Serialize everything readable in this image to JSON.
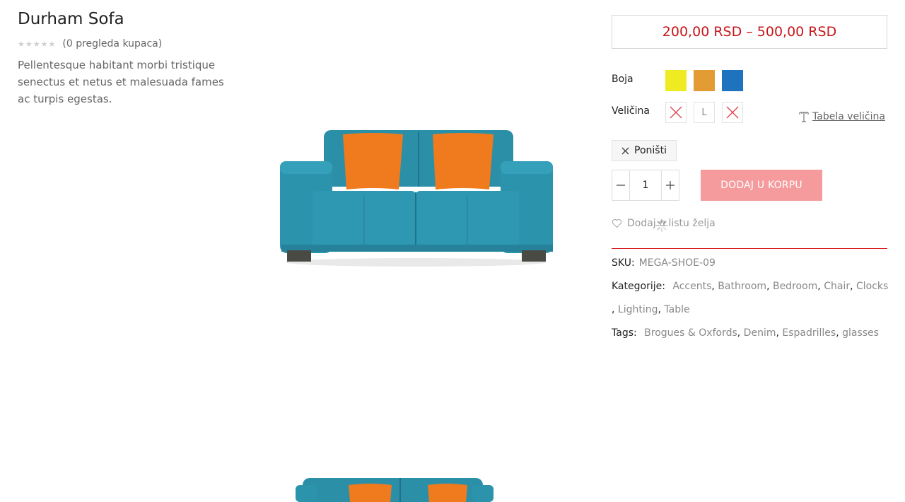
{
  "product": {
    "title": "Durham Sofa",
    "review_count_text": "(0 pregleda kupaca)",
    "rating": 0,
    "rating_max": 5,
    "description": "Pellentesque habitant morbi tristique senectus et netus et malesuada fames ac turpis egestas."
  },
  "price": {
    "text": "200,00 RSD – 500,00 RSD",
    "color": "#c6161a"
  },
  "options": {
    "color_label": "Boja",
    "colors": [
      "#eeeb22",
      "#e39b33",
      "#1e73be"
    ],
    "size_label": "Veličina",
    "sizes": [
      {
        "label": "",
        "state": "unavailable"
      },
      {
        "label": "L",
        "state": "available"
      },
      {
        "label": "",
        "state": "unavailable"
      }
    ],
    "size_chart_label": "Tabela veličina",
    "size_chart_icon": "ruler-icon"
  },
  "reset": {
    "label": "Poništi",
    "icon": "close-icon"
  },
  "quantity": {
    "value": "1",
    "minus": "–",
    "plus": "+"
  },
  "cart": {
    "label": "DODAJ U KORPU",
    "color": "#f59a9d"
  },
  "wishlist": {
    "label": "Dodaj u listu želja",
    "icon": "heart-icon"
  },
  "meta": {
    "sku_label": "SKU:",
    "sku_value": "MEGA-SHOE-09",
    "categories_label": "Kategorije:",
    "categories_line1": [
      "Accents",
      "Bathroom",
      "Bedroom",
      "Chair",
      "Clocks"
    ],
    "categories_line2": [
      "Lighting",
      "Table"
    ],
    "tags_label": "Tags:",
    "tags": [
      "Brogues & Oxfords",
      "Denim",
      "Espadrilles",
      "glasses"
    ]
  },
  "accent_color": "#d71920"
}
